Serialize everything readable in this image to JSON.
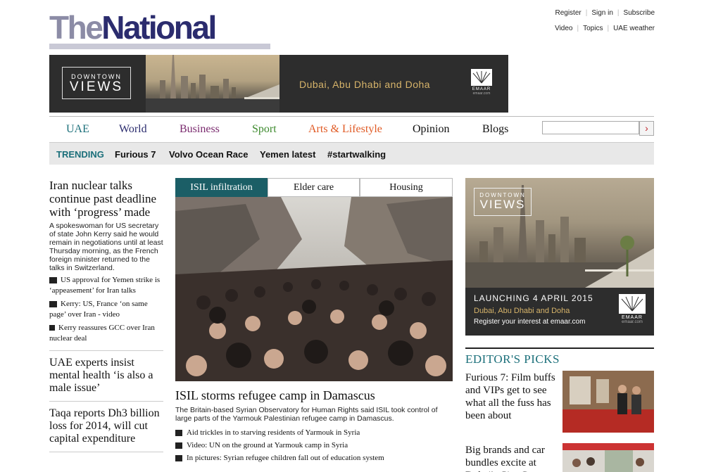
{
  "logo": {
    "part1": "The",
    "part2": "National"
  },
  "top_links": {
    "row1": [
      "Register",
      "Sign in",
      "Subscribe"
    ],
    "row2": [
      "Video",
      "Topics",
      "UAE weather"
    ]
  },
  "ad_top": {
    "brand_line1": "DOWNTOWN",
    "brand_line2": "VIEWS",
    "tagline": "Dubai, Abu Dhabi and Doha",
    "sponsor": "EMAAR",
    "sponsor_url": "emaar.com"
  },
  "nav": {
    "items": [
      {
        "label": "UAE",
        "color": "#1b6f7a"
      },
      {
        "label": "World",
        "color": "#2b2c6e"
      },
      {
        "label": "Business",
        "color": "#7a2a6e"
      },
      {
        "label": "Sport",
        "color": "#3d8a2e"
      },
      {
        "label": "Arts & Lifestyle",
        "color": "#e05a24"
      },
      {
        "label": "Opinion",
        "color": "#111111"
      },
      {
        "label": "Blogs",
        "color": "#111111"
      }
    ],
    "search_placeholder": "",
    "search_icon": "chevron-right-icon"
  },
  "trending": {
    "label": "TRENDING",
    "items": [
      "Furious 7",
      "Volvo Ocean Race",
      "Yemen latest",
      "#startwalking"
    ]
  },
  "left": {
    "lead": {
      "headline": "Iran nuclear talks continue past deadline with ‘progress’ made",
      "summary": "A spokeswoman for US secretary of state John Kerry said he would remain in negotiations until at least Thursday morning, as the French foreign minister returned to the talks in Switzerland.",
      "related": [
        {
          "icon": "comment-icon",
          "text": "US approval for Yemen strike is ‘appeasement’ for Iran talks"
        },
        {
          "icon": "video-icon",
          "text": "Kerry: US, France ‘on same page’ over Iran - video"
        },
        {
          "icon": "article-icon",
          "text": "Kerry reassures GCC over Iran nuclear deal"
        }
      ]
    },
    "story2": "UAE experts insist mental health ‘is also a male issue’",
    "story3": "Taqa reports Dh3 billion loss for 2014, will cut capital expenditure"
  },
  "center": {
    "tabs": [
      "ISIL infiltration",
      "Elder care",
      "Housing"
    ],
    "headline": "ISIL storms refugee camp in Damascus",
    "summary": "The Britain-based Syrian Observatory for Human Rights said ISIL took control of large parts of the Yarmouk Palestinian refugee camp in Damascus.",
    "related": [
      {
        "icon": "article-icon",
        "text": "Aid trickles in to starving residents of Yarmouk in Syria"
      },
      {
        "icon": "video-icon",
        "text": "Video: UN on the ground at Yarmouk camp in Syria"
      },
      {
        "icon": "camera-icon",
        "text": "In pictures: Syrian refugee children fall out of education system"
      }
    ]
  },
  "ad_right": {
    "brand_line1": "DOWNTOWN",
    "brand_line2": "VIEWS",
    "launch": "LAUNCHING 4 APRIL 2015",
    "tagline": "Dubai, Abu Dhabi and Doha",
    "register": "Register your interest at emaar.com",
    "sponsor": "EMAAR",
    "sponsor_url": "emaar.com"
  },
  "editors_picks": {
    "title": "EDITOR'S PICKS",
    "items": [
      {
        "headline": "Furious 7: Film buffs and VIPs get to see what all the fuss has been about"
      },
      {
        "headline": "Big brands and car bundles excite at Dubai's City Centre"
      }
    ]
  }
}
